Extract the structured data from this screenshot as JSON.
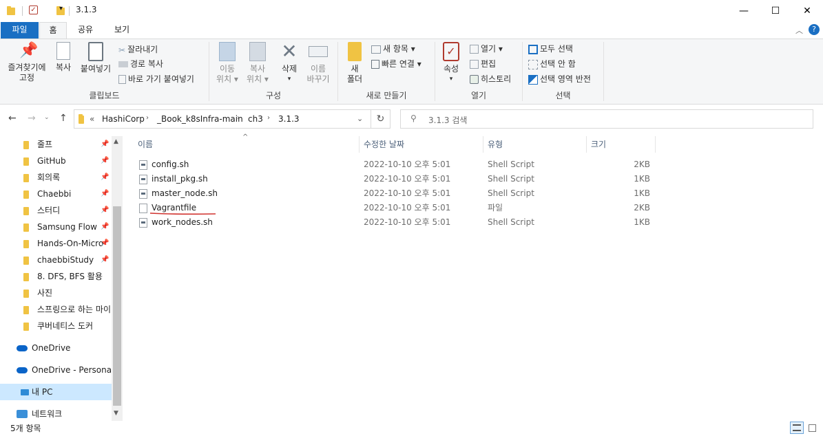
{
  "window": {
    "title": "3.1.3",
    "minimize": "—",
    "maximize": "☐",
    "close": "✕"
  },
  "tabs": [
    {
      "label": "파일"
    },
    {
      "label": "홈"
    },
    {
      "label": "공유"
    },
    {
      "label": "보기"
    }
  ],
  "ribbon": {
    "clipboard": {
      "label": "클립보드",
      "pin": [
        "즐겨찾기에",
        "고정"
      ],
      "copy": "복사",
      "paste": "붙여넣기",
      "cut": "잘라내기",
      "copy_path": "경로 복사",
      "paste_shortcut": "바로 가기 붙여넣기"
    },
    "organize": {
      "label": "구성",
      "move": [
        "이동",
        "위치 ▾"
      ],
      "copy_to": [
        "복사",
        "위치 ▾"
      ],
      "delete": "삭제",
      "rename": [
        "이름",
        "바꾸기"
      ]
    },
    "new": {
      "label": "새로 만들기",
      "folder": [
        "새",
        "폴더"
      ],
      "new_item": "새 항목 ▾",
      "easy_access": "빠른 연결 ▾"
    },
    "open": {
      "label": "열기",
      "properties": "속성",
      "open": "열기 ▾",
      "edit": "편집",
      "history": "히스토리"
    },
    "select": {
      "label": "선택",
      "select_all": "모두 선택",
      "select_none": "선택 안 함",
      "invert": "선택 영역 반전"
    }
  },
  "address": {
    "crumbs": [
      "HashiCorp",
      "_Book_k8sInfra-main",
      "ch3",
      "3.1.3"
    ],
    "overflow": "«",
    "search_placeholder": "3.1.3 검색"
  },
  "navpane": {
    "quick_access": [
      {
        "label": "줄프",
        "pinned": true
      },
      {
        "label": "GitHub",
        "pinned": true
      },
      {
        "label": "회의록",
        "pinned": true
      },
      {
        "label": "Chaebbi",
        "pinned": true
      },
      {
        "label": "스터디",
        "pinned": true
      },
      {
        "label": "Samsung Flow",
        "pinned": true
      },
      {
        "label": "Hands-On-Micro",
        "pinned": true
      },
      {
        "label": "chaebbiStudy",
        "pinned": true
      },
      {
        "label": "8. DFS, BFS 활용",
        "pinned": false
      },
      {
        "label": "사진",
        "pinned": false
      },
      {
        "label": "스프링으로 하는 마이",
        "pinned": false
      },
      {
        "label": "쿠버네티스 도커",
        "pinned": false
      }
    ],
    "onedrive": "OneDrive",
    "onedrive_personal": "OneDrive - Personal",
    "this_pc": "내 PC",
    "network": "네트워크"
  },
  "columns": {
    "name": "이름",
    "date": "수정한 날짜",
    "type": "유형",
    "size": "크기"
  },
  "files": [
    {
      "name": "config.sh",
      "date": "2022-10-10 오후 5:01",
      "type": "Shell Script",
      "size": "2KB",
      "icon": "script-icon"
    },
    {
      "name": "install_pkg.sh",
      "date": "2022-10-10 오후 5:01",
      "type": "Shell Script",
      "size": "1KB",
      "icon": "script-icon"
    },
    {
      "name": "master_node.sh",
      "date": "2022-10-10 오후 5:01",
      "type": "Shell Script",
      "size": "1KB",
      "icon": "script-icon"
    },
    {
      "name": "Vagrantfile",
      "date": "2022-10-10 오후 5:01",
      "type": "파일",
      "size": "2KB",
      "icon": "file-icon"
    },
    {
      "name": "work_nodes.sh",
      "date": "2022-10-10 오후 5:01",
      "type": "Shell Script",
      "size": "1KB",
      "icon": "script-icon"
    }
  ],
  "status": {
    "count": "5개 항목"
  },
  "colors": {
    "accent": "#1a6fc3",
    "folder": "#f0c343",
    "annotation": "#d0312d"
  }
}
